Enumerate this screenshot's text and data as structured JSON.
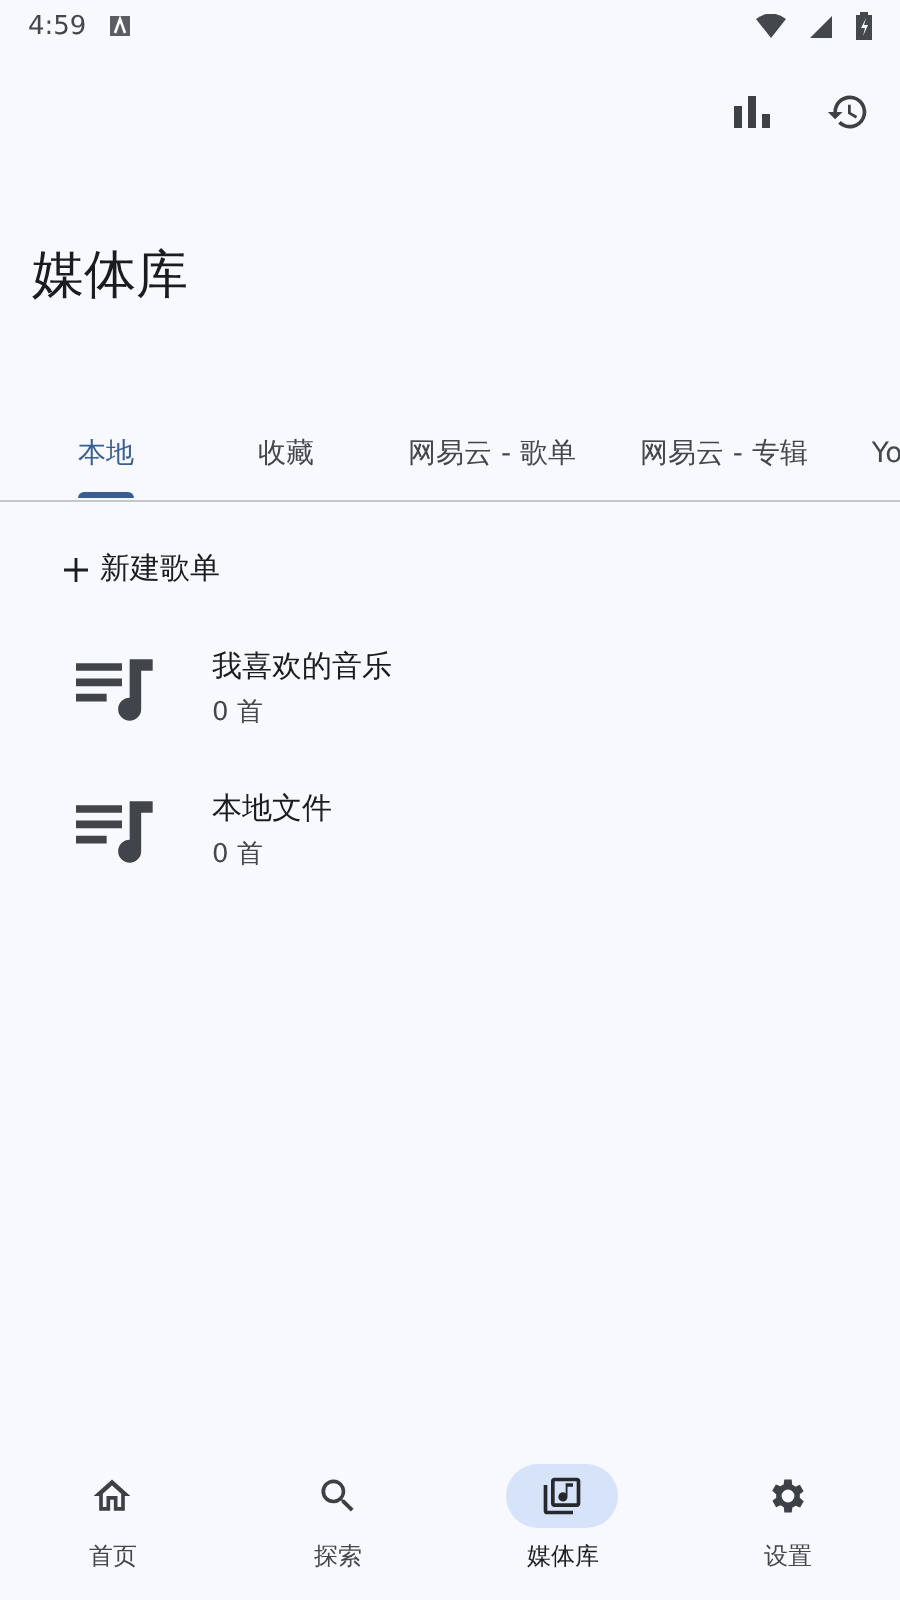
{
  "status_bar": {
    "time": "4:59"
  },
  "title": "媒体库",
  "tabs": [
    {
      "label": "本地",
      "selected": true
    },
    {
      "label": "收藏",
      "selected": false
    },
    {
      "label": "网易云 - 歌单",
      "selected": false
    },
    {
      "label": "网易云 - 专辑",
      "selected": false
    },
    {
      "label": "Yo",
      "selected": false
    }
  ],
  "new_playlist": {
    "label": "新建歌单"
  },
  "playlists": [
    {
      "name": "我喜欢的音乐",
      "count": "0 首"
    },
    {
      "name": "本地文件",
      "count": "0 首"
    }
  ],
  "bottom_nav": [
    {
      "label": "首页",
      "kind": "home",
      "selected": false
    },
    {
      "label": "探索",
      "kind": "search",
      "selected": false
    },
    {
      "label": "媒体库",
      "kind": "library",
      "selected": true
    },
    {
      "label": "设置",
      "kind": "settings",
      "selected": false
    }
  ]
}
